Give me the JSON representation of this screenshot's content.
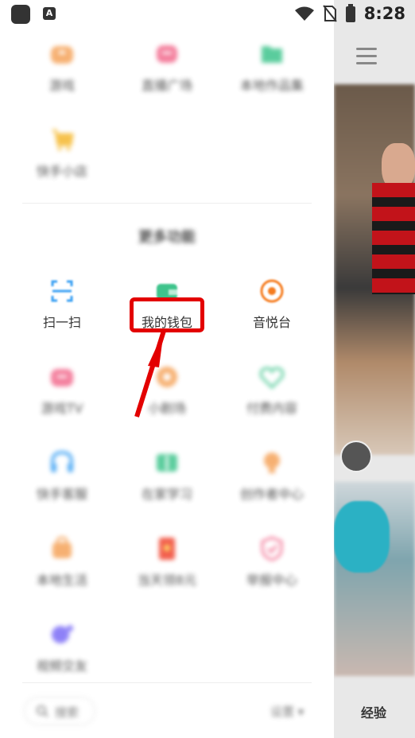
{
  "status_bar": {
    "time": "8:28",
    "notif_letter": "A"
  },
  "drawer": {
    "top_row": [
      {
        "label": "游戏",
        "icon": "game-icon",
        "color": "#f5a35a"
      },
      {
        "label": "直播广场",
        "icon": "live-icon",
        "color": "#f26a8d"
      },
      {
        "label": "本地作品集",
        "icon": "folder-icon",
        "color": "#3ec48c"
      }
    ],
    "row_shop": [
      {
        "label": "快手小店",
        "icon": "cart-icon",
        "color": "#f5b82e"
      }
    ],
    "section_title": "更多功能",
    "more_row1": [
      {
        "label": "扫一扫",
        "icon": "scan-icon",
        "color": "#3aa0f3"
      },
      {
        "label": "我的钱包",
        "icon": "wallet-icon",
        "color": "#3ec48c"
      },
      {
        "label": "音悦台",
        "icon": "music-icon",
        "color": "#f57c1f"
      }
    ],
    "more_row2": [
      {
        "label": "游戏TV",
        "icon": "tv-icon",
        "color": "#f26a8d"
      },
      {
        "label": "小剧场",
        "icon": "theater-icon",
        "color": "#f5a35a"
      },
      {
        "label": "付费内容",
        "icon": "heart-shield-icon",
        "color": "#3ec48c"
      }
    ],
    "more_row3": [
      {
        "label": "快手客服",
        "icon": "headset-icon",
        "color": "#3aa0f3"
      },
      {
        "label": "在家学习",
        "icon": "book-icon",
        "color": "#3ec48c"
      },
      {
        "label": "创作者中心",
        "icon": "bulb-icon",
        "color": "#f5a35a"
      }
    ],
    "more_row4": [
      {
        "label": "本地生活",
        "icon": "bag-icon",
        "color": "#f5a35a"
      },
      {
        "label": "当天领8元",
        "icon": "redpacket-icon",
        "color": "#f0442f"
      },
      {
        "label": "举报中心",
        "icon": "shield-icon",
        "color": "#f26a8d"
      }
    ],
    "more_row5": [
      {
        "label": "视频交友",
        "icon": "video-chat-icon",
        "color": "#7b6cf6"
      }
    ],
    "bottom": {
      "search_label": "搜索",
      "settings_label": "设置"
    }
  },
  "right_panel": {
    "bottom_tab": "经验"
  }
}
